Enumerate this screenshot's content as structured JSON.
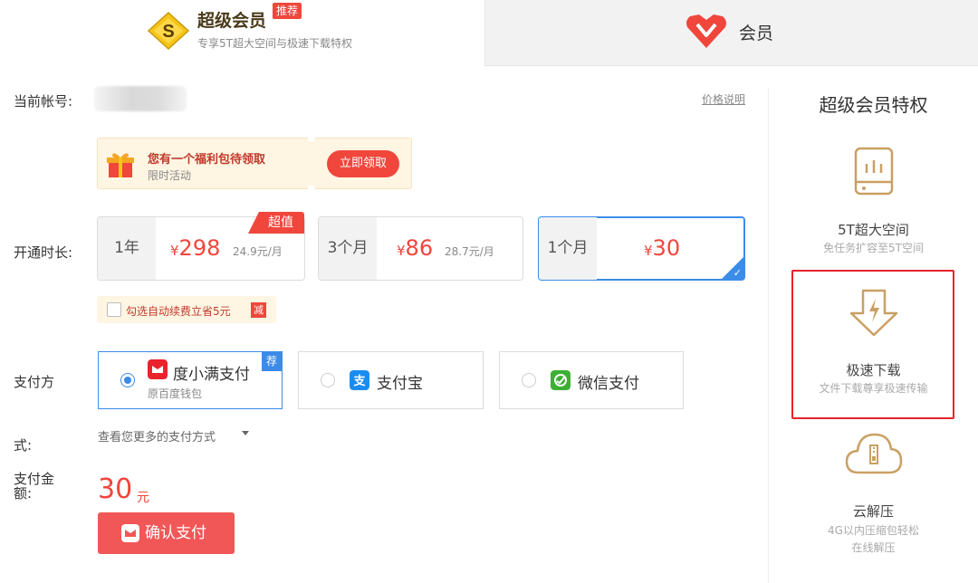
{
  "tabs": {
    "svip": {
      "title": "超级会员",
      "tag": "推荐",
      "subtitle": "专享5T超大空间与极速下载特权"
    },
    "vip": {
      "title": "会员"
    }
  },
  "account": {
    "label": "当前帐号:",
    "price_note": "价格说明"
  },
  "coupon": {
    "title": "您有一个福利包待领取",
    "subtitle": "限时活动",
    "button": "立即领取"
  },
  "duration": {
    "label": "开通时长:",
    "value_tag": "超值",
    "plans": [
      {
        "term": "1年",
        "currency": "¥",
        "price": "298",
        "monthly": "24.9元/月"
      },
      {
        "term": "3个月",
        "currency": "¥",
        "price": "86",
        "monthly": "28.7元/月"
      },
      {
        "term": "1个月",
        "currency": "¥",
        "price": "30",
        "monthly": ""
      }
    ],
    "selected_index": 2,
    "auto_renew": {
      "text": "勾选自动续费立省5元",
      "badge": "减"
    }
  },
  "payment": {
    "label_line1": "支付方",
    "label_line2": "式:",
    "rec_tag": "荐",
    "methods": [
      {
        "name": "度小满支付",
        "sub": "原百度钱包"
      },
      {
        "name": "支付宝",
        "sub": ""
      },
      {
        "name": "微信支付",
        "sub": ""
      }
    ],
    "more": "查看您更多的支付方式"
  },
  "amount": {
    "label": "支付金额:",
    "value": "30",
    "unit": "元",
    "confirm": "确认支付"
  },
  "side": {
    "title": "超级会员特权",
    "features": [
      {
        "name": "5T超大空间",
        "desc": "免任务扩容至5T空间"
      },
      {
        "name": "极速下载",
        "desc": "文件下载尊享极速传输"
      },
      {
        "name": "云解压",
        "desc": "4G以内压缩包轻松",
        "desc2": "在线解压"
      }
    ]
  },
  "colors": {
    "accent_red": "#f0463c",
    "selected_blue": "#3b8ce8",
    "gold": "#c9a063"
  }
}
